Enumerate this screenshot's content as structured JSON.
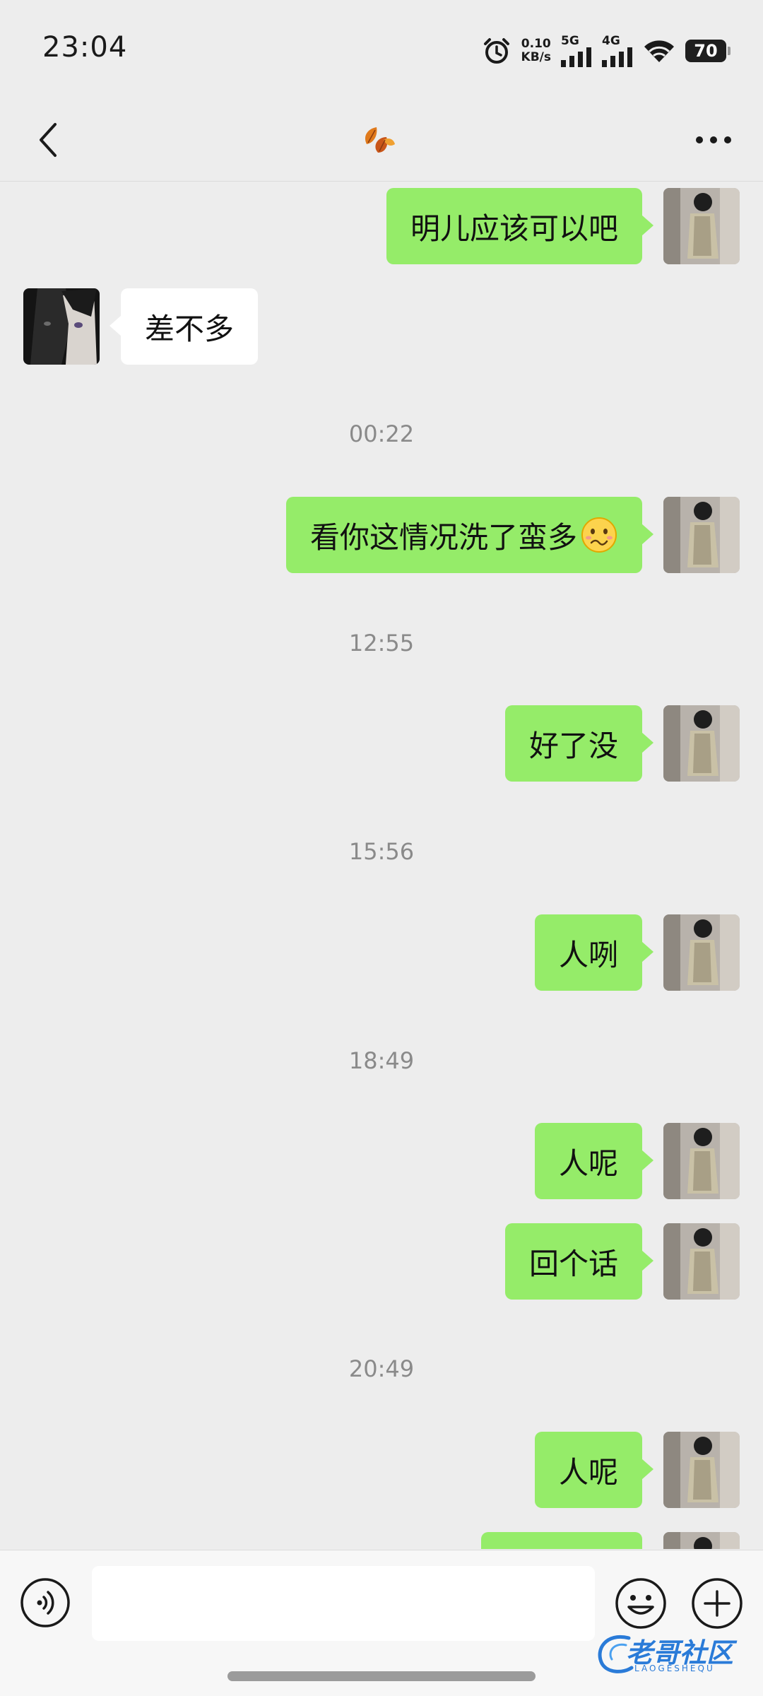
{
  "status_bar": {
    "time": "23:04",
    "net_speed_value": "0.10",
    "net_speed_unit": "KB/s",
    "signal_1_label": "5G",
    "signal_2_label": "4G",
    "battery": "70"
  },
  "nav": {
    "title_icon": "autumn-leaves-emoji"
  },
  "timestamps": [
    "00:22",
    "12:55",
    "15:56",
    "18:49",
    "20:49"
  ],
  "messages": [
    {
      "from": "me",
      "text": "明儿应该可以吧"
    },
    {
      "from": "contact",
      "text": "差不多"
    },
    {
      "from": "me",
      "text": "看你这情况洗了蛮多"
    },
    {
      "from": "me",
      "text": "好了没"
    },
    {
      "from": "me",
      "text": "人咧"
    },
    {
      "from": "me",
      "text": "人呢"
    },
    {
      "from": "me",
      "text": "回个话"
    },
    {
      "from": "me",
      "text": "人呢"
    }
  ],
  "input": {
    "placeholder": "",
    "value": ""
  },
  "watermark": {
    "text": "老哥社区",
    "sub": "LAOGESHEQU"
  },
  "colors": {
    "background": "#ededed",
    "outgoing_bubble": "#95ec69",
    "incoming_bubble": "#ffffff",
    "timestamp": "#8a8a8a"
  }
}
